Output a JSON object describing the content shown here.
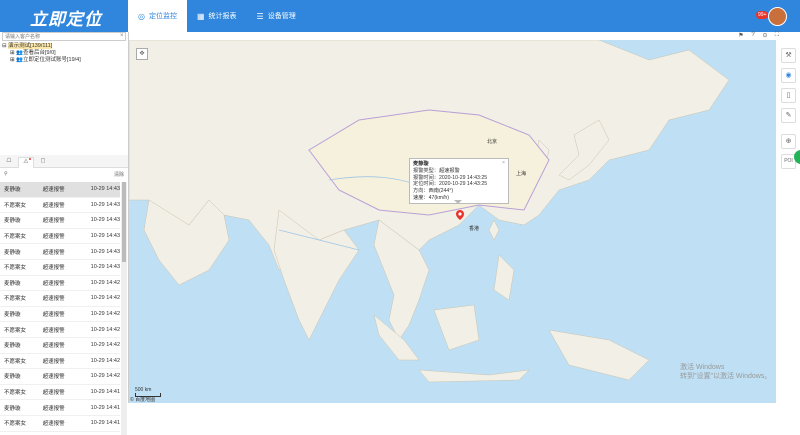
{
  "app": {
    "logo": "立即定位"
  },
  "nav": [
    {
      "icon": "◎",
      "label": "定位监控"
    },
    {
      "icon": "▦",
      "label": "统计报表"
    },
    {
      "icon": "☰",
      "label": "设备管理"
    }
  ],
  "user": {
    "badge": "99+"
  },
  "search": {
    "placeholder": "请输入客户名称",
    "clear": "×"
  },
  "tree": {
    "root": "演示测试[139/111]",
    "children": [
      "查看后台[9/0]",
      "立即定位测试账号[19/4]"
    ]
  },
  "tabs": [
    "☖",
    "⚠",
    "◻"
  ],
  "alarm_list": {
    "filter_icon": "⚲",
    "clear_label": "清除",
    "rows": [
      {
        "name": "麦静璇",
        "type": "超速报警",
        "time": "10-29 14:43"
      },
      {
        "name": "不愿案女",
        "type": "超速报警",
        "time": "10-29 14:43"
      },
      {
        "name": "麦静璇",
        "type": "超速报警",
        "time": "10-29 14:43"
      },
      {
        "name": "不愿案女",
        "type": "超速报警",
        "time": "10-29 14:43"
      },
      {
        "name": "麦静璇",
        "type": "超速报警",
        "time": "10-29 14:43"
      },
      {
        "name": "不愿案女",
        "type": "超速报警",
        "time": "10-29 14:43"
      },
      {
        "name": "麦静璇",
        "type": "超速报警",
        "time": "10-29 14:42"
      },
      {
        "name": "不愿案女",
        "type": "超速报警",
        "time": "10-29 14:42"
      },
      {
        "name": "麦静璇",
        "type": "超速报警",
        "time": "10-29 14:42"
      },
      {
        "name": "不愿案女",
        "type": "超速报警",
        "time": "10-29 14:42"
      },
      {
        "name": "麦静璇",
        "type": "超速报警",
        "time": "10-29 14:42"
      },
      {
        "name": "不愿案女",
        "type": "超速报警",
        "time": "10-29 14:42"
      },
      {
        "name": "麦静璇",
        "type": "超速报警",
        "time": "10-29 14:42"
      },
      {
        "name": "不愿案女",
        "type": "超速报警",
        "time": "10-29 14:41"
      },
      {
        "name": "麦静璇",
        "type": "超速报警",
        "time": "10-29 14:41"
      },
      {
        "name": "不愿案女",
        "type": "超速报警",
        "time": "10-29 14:41"
      },
      {
        "name": "麦静璇",
        "type": "超速报警",
        "time": "10-29 14:41"
      }
    ]
  },
  "popup": {
    "title": "麦静璇",
    "lines": [
      "报警类型：超速报警",
      "报警时间：2020-10-29 14:43:25",
      "定位时间：2020-10-29 14:43:25",
      "方向：西南(244°)",
      "速度：47(km/h)"
    ],
    "close": "×"
  },
  "map": {
    "labels": [
      "北京",
      "上海",
      "香港"
    ],
    "scale": "500 km",
    "copyright": "© 百度地图",
    "watermark": [
      "激活 Windows",
      "转到\"设置\"以激活 Windows。"
    ]
  },
  "map_tools": [
    "⚑",
    "?",
    "⊙",
    "⛶"
  ],
  "right_tools": [
    "⚒",
    "◉",
    "▯",
    "✎",
    "⊕",
    "POI"
  ],
  "colors": {
    "header": "#2f86dc",
    "marker": "#e8332c",
    "sea": "#bfe0f4",
    "land": "#f2efe6"
  }
}
